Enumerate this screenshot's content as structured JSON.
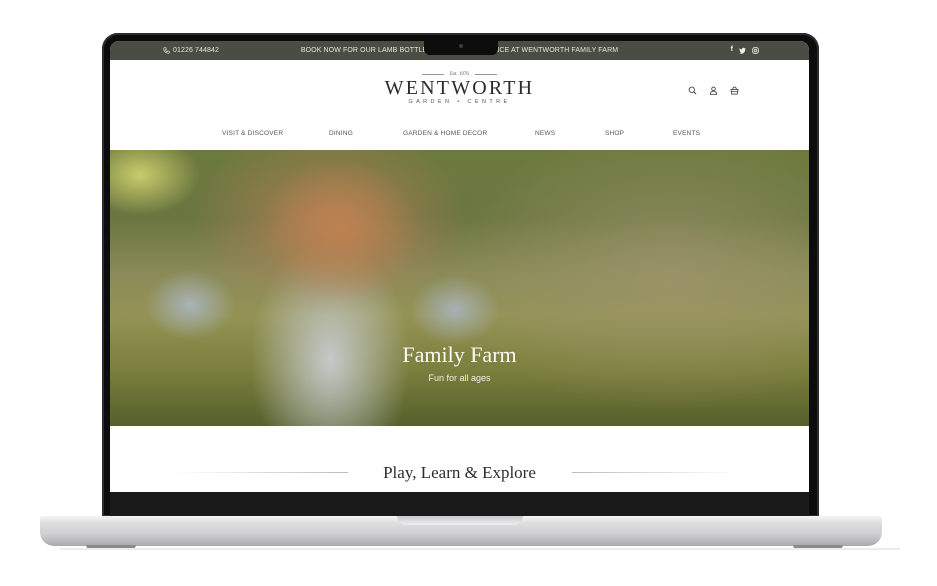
{
  "topbar": {
    "phone_icon": "phone-icon",
    "phone": "01226 744842",
    "announcement": "BOOK NOW FOR OUR LAMB BOTTLE FEEDING EXPERIENCE AT WENTWORTH FAMILY FARM",
    "social": [
      {
        "icon": "facebook-icon",
        "glyph": "f"
      },
      {
        "icon": "twitter-icon",
        "glyph": "🐦"
      },
      {
        "icon": "instagram-icon",
        "glyph": "◎"
      }
    ]
  },
  "logo": {
    "est": "Est. 1976",
    "name": "WENTWORTH",
    "sub": "GARDEN • CENTRE"
  },
  "header_icons": [
    "search-icon",
    "account-icon",
    "basket-icon"
  ],
  "nav": [
    {
      "label": "VISIT & DISCOVER"
    },
    {
      "label": "DINING"
    },
    {
      "label": "GARDEN & HOME DECOR"
    },
    {
      "label": "NEWS"
    },
    {
      "label": "SHOP"
    },
    {
      "label": "EVENTS"
    }
  ],
  "hero": {
    "title": "Family Farm",
    "subtitle": "Fun for all ages"
  },
  "section": {
    "heading": "Play, Learn & Explore"
  },
  "colors": {
    "topbar_bg": "#4a4d43",
    "text_dark": "#2b2b2b"
  }
}
